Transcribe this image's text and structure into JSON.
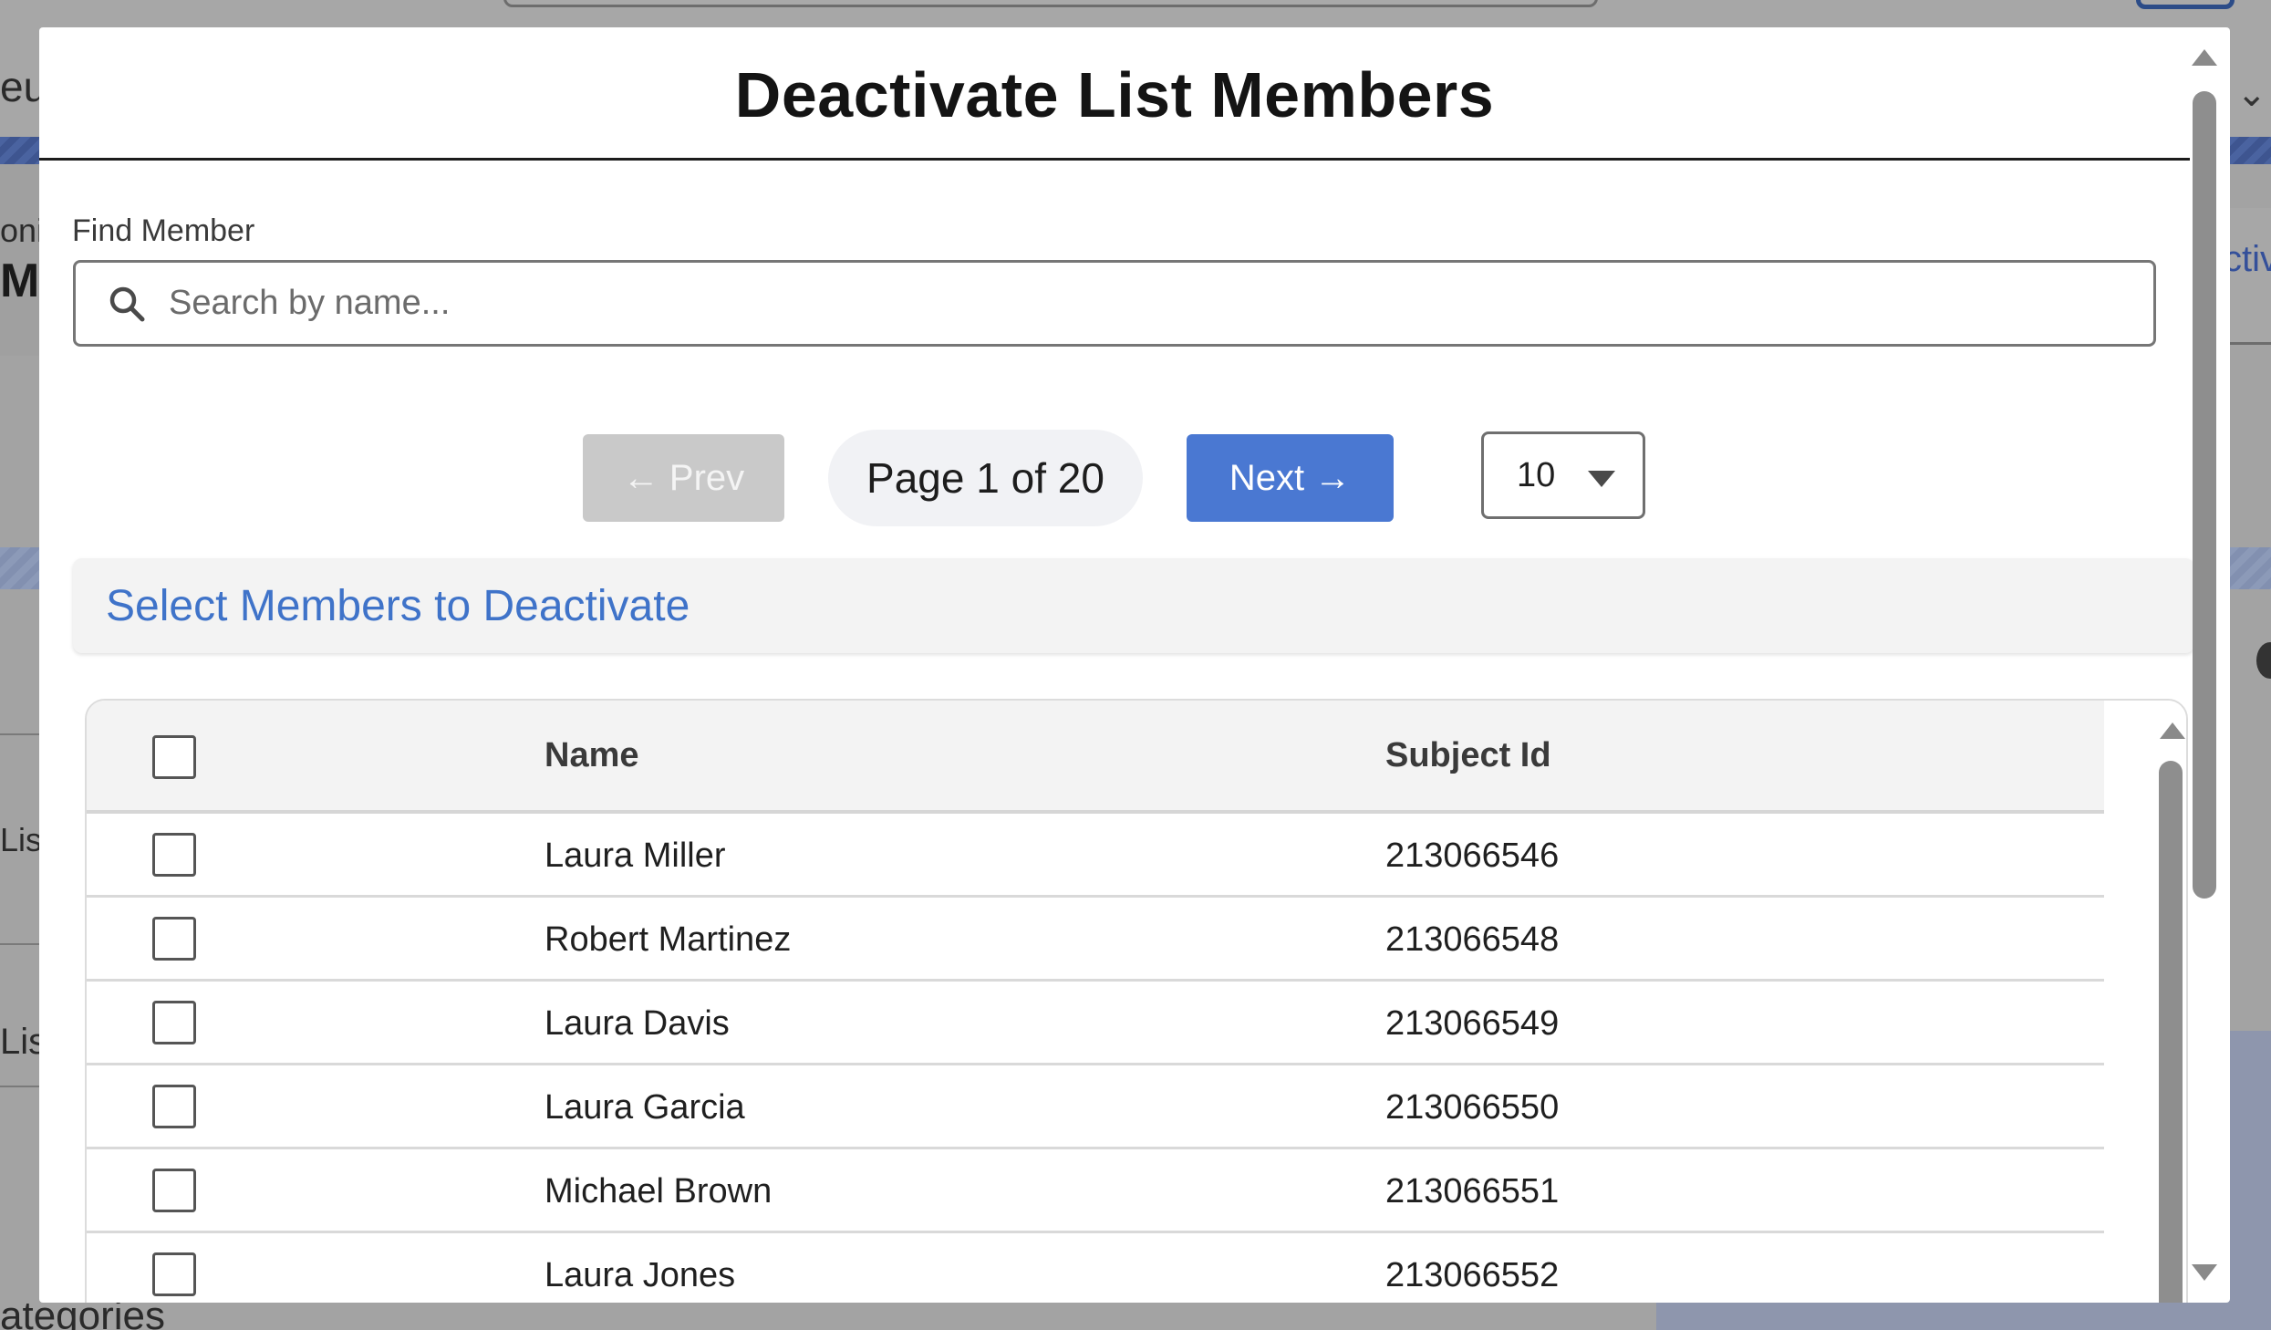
{
  "modal": {
    "title": "Deactivate List Members"
  },
  "search": {
    "label": "Find Member",
    "placeholder": "Search by name...",
    "value": ""
  },
  "pagination": {
    "prev_label": "← Prev",
    "prev_enabled": false,
    "page_text": "Page 1 of 20",
    "next_label": "Next →",
    "page_size": "10"
  },
  "section": {
    "title": "Select Members to Deactivate"
  },
  "table": {
    "columns": [
      "Name",
      "Subject Id"
    ],
    "rows": [
      {
        "name": "Laura Miller",
        "subject_id": "213066546"
      },
      {
        "name": "Robert Martinez",
        "subject_id": "213066548"
      },
      {
        "name": "Laura Davis",
        "subject_id": "213066549"
      },
      {
        "name": "Laura Garcia",
        "subject_id": "213066550"
      },
      {
        "name": "Michael Brown",
        "subject_id": "213066551"
      },
      {
        "name": "Laura Jones",
        "subject_id": "213066552"
      }
    ]
  },
  "background": {
    "text_1": "eu",
    "text_2": "oni",
    "text_3": "Mo",
    "text_4": "List",
    "text_5": "Lis",
    "text_6": "ategories",
    "text_7": "ctiv"
  },
  "colors": {
    "accent": "#4a78d2",
    "section_title": "#3f73c9",
    "disabled_button": "#c9c9c9"
  }
}
